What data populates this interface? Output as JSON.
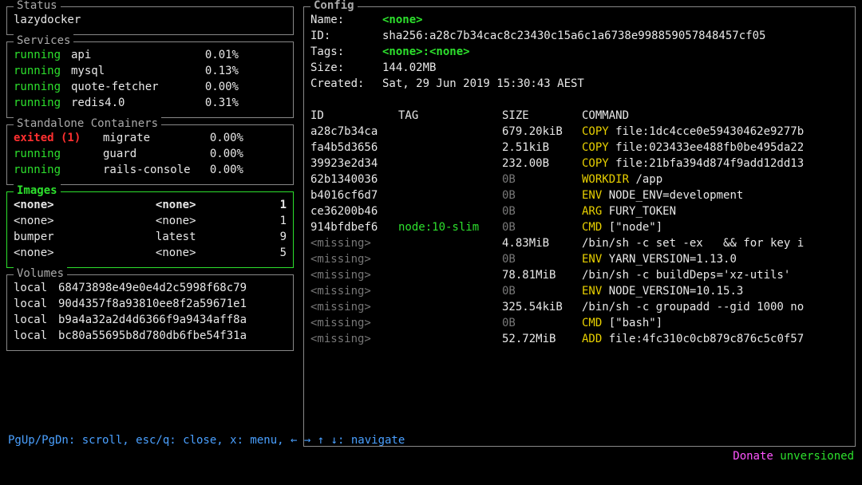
{
  "status": {
    "title": "Status",
    "value": "lazydocker"
  },
  "services": {
    "title": "Services",
    "items": [
      {
        "status": "running",
        "status_class": "c-green",
        "name": "api",
        "pct": "0.01%"
      },
      {
        "status": "running",
        "status_class": "c-green",
        "name": "mysql",
        "pct": "0.13%"
      },
      {
        "status": "running",
        "status_class": "c-green",
        "name": "quote-fetcher",
        "pct": "0.00%"
      },
      {
        "status": "running",
        "status_class": "c-green",
        "name": "redis4.0",
        "pct": "0.31%"
      }
    ]
  },
  "standalone": {
    "title": "Standalone Containers",
    "items": [
      {
        "status": "exited (1)",
        "status_class": "c-red-b",
        "name": "migrate",
        "pct": "0.00%"
      },
      {
        "status": "running",
        "status_class": "c-green",
        "name": "guard",
        "pct": "0.00%"
      },
      {
        "status": "running",
        "status_class": "c-green",
        "name": "rails-console",
        "pct": "0.00%"
      }
    ]
  },
  "images": {
    "title": "Images",
    "items": [
      {
        "repo": "<none>",
        "tag": "<none>",
        "count": "1",
        "bold": true
      },
      {
        "repo": "<none>",
        "tag": "<none>",
        "count": "1",
        "bold": false
      },
      {
        "repo": "bumper",
        "tag": "latest",
        "count": "9",
        "bold": false
      },
      {
        "repo": "<none>",
        "tag": "<none>",
        "count": "5",
        "bold": false
      }
    ]
  },
  "volumes": {
    "title": "Volumes",
    "items": [
      {
        "scope": "local",
        "name": "68473898e49e0e4d2c5998f68c79"
      },
      {
        "scope": "local",
        "name": "90d4357f8a93810ee8f2a59671e1"
      },
      {
        "scope": "local",
        "name": "b9a4a32a2d4d6366f9a9434aff8a"
      },
      {
        "scope": "local",
        "name": "bc80a55695b8d780db6fbe54f31a"
      }
    ]
  },
  "config": {
    "title": "Config",
    "meta": {
      "name_label": "Name:",
      "name_value": "<none>",
      "id_label": "ID:",
      "id_value": "sha256:a28c7b34cac8c23430c15a6c1a6738e998859057848457cf05",
      "tags_label": "Tags:",
      "tags_value": "<none>:<none>",
      "size_label": "Size:",
      "size_value": "144.02MB",
      "created_label": "Created:",
      "created_value": "Sat, 29 Jun 2019 15:30:43 AEST"
    },
    "headers": {
      "id": "ID",
      "tag": "TAG",
      "size": "SIZE",
      "command": "COMMAND"
    },
    "layers": [
      {
        "id": "a28c7b34ca",
        "id_class": "c-white",
        "tag": "",
        "size": "679.20kiB",
        "size_class": "c-white",
        "cmd_kw": "COPY",
        "cmd_kw_class": "c-yellow",
        "cmd_rest": " file:1dc4cce0e59430462e9277b"
      },
      {
        "id": "fa4b5d3656",
        "id_class": "c-white",
        "tag": "",
        "size": "2.51kiB",
        "size_class": "c-white",
        "cmd_kw": "COPY",
        "cmd_kw_class": "c-yellow",
        "cmd_rest": " file:023433ee488fb0be495da22"
      },
      {
        "id": "39923e2d34",
        "id_class": "c-white",
        "tag": "",
        "size": "232.00B",
        "size_class": "c-white",
        "cmd_kw": "COPY",
        "cmd_kw_class": "c-yellow",
        "cmd_rest": " file:21bfa394d874f9add12dd13"
      },
      {
        "id": "62b1340036",
        "id_class": "c-white",
        "tag": "",
        "size": "0B",
        "size_class": "c-dim",
        "cmd_kw": "WORKDIR",
        "cmd_kw_class": "c-yellow",
        "cmd_rest": " /app"
      },
      {
        "id": "b4016cf6d7",
        "id_class": "c-white",
        "tag": "",
        "size": "0B",
        "size_class": "c-dim",
        "cmd_kw": "ENV",
        "cmd_kw_class": "c-yellow",
        "cmd_rest": " NODE_ENV=development"
      },
      {
        "id": "ce36200b46",
        "id_class": "c-white",
        "tag": "",
        "size": "0B",
        "size_class": "c-dim",
        "cmd_kw": "ARG",
        "cmd_kw_class": "c-yellow",
        "cmd_rest": " FURY_TOKEN"
      },
      {
        "id": "914bfdbef6",
        "id_class": "c-white",
        "tag": "node:10-slim",
        "tag_class": "c-green",
        "size": "0B",
        "size_class": "c-dim",
        "cmd_kw": "CMD",
        "cmd_kw_class": "c-yellow",
        "cmd_rest": " [\"node\"]"
      },
      {
        "id": "<missing>",
        "id_class": "c-dim",
        "tag": "",
        "size": "4.83MiB",
        "size_class": "c-white",
        "cmd_kw": "",
        "cmd_kw_class": "",
        "cmd_rest": "/bin/sh -c set -ex   && for key i"
      },
      {
        "id": "<missing>",
        "id_class": "c-dim",
        "tag": "",
        "size": "0B",
        "size_class": "c-dim",
        "cmd_kw": "ENV",
        "cmd_kw_class": "c-yellow",
        "cmd_rest": " YARN_VERSION=1.13.0"
      },
      {
        "id": "<missing>",
        "id_class": "c-dim",
        "tag": "",
        "size": "78.81MiB",
        "size_class": "c-white",
        "cmd_kw": "",
        "cmd_kw_class": "",
        "cmd_rest": "/bin/sh -c buildDeps='xz-utils'"
      },
      {
        "id": "<missing>",
        "id_class": "c-dim",
        "tag": "",
        "size": "0B",
        "size_class": "c-dim",
        "cmd_kw": "ENV",
        "cmd_kw_class": "c-yellow",
        "cmd_rest": " NODE_VERSION=10.15.3"
      },
      {
        "id": "<missing>",
        "id_class": "c-dim",
        "tag": "",
        "size": "325.54kiB",
        "size_class": "c-white",
        "cmd_kw": "",
        "cmd_kw_class": "",
        "cmd_rest": "/bin/sh -c groupadd --gid 1000 no"
      },
      {
        "id": "<missing>",
        "id_class": "c-dim",
        "tag": "",
        "size": "0B",
        "size_class": "c-dim",
        "cmd_kw": "CMD",
        "cmd_kw_class": "c-yellow",
        "cmd_rest": " [\"bash\"]"
      },
      {
        "id": "<missing>",
        "id_class": "c-dim",
        "tag": "",
        "size": "52.72MiB",
        "size_class": "c-white",
        "cmd_kw": "ADD",
        "cmd_kw_class": "c-yellow",
        "cmd_rest": " file:4fc310c0cb879c876c5c0f57"
      }
    ]
  },
  "footer": {
    "help": "PgUp/PgDn: scroll, esc/q: close, x: menu, ← → ↑ ↓: navigate",
    "donate": "Donate",
    "version": "unversioned"
  }
}
